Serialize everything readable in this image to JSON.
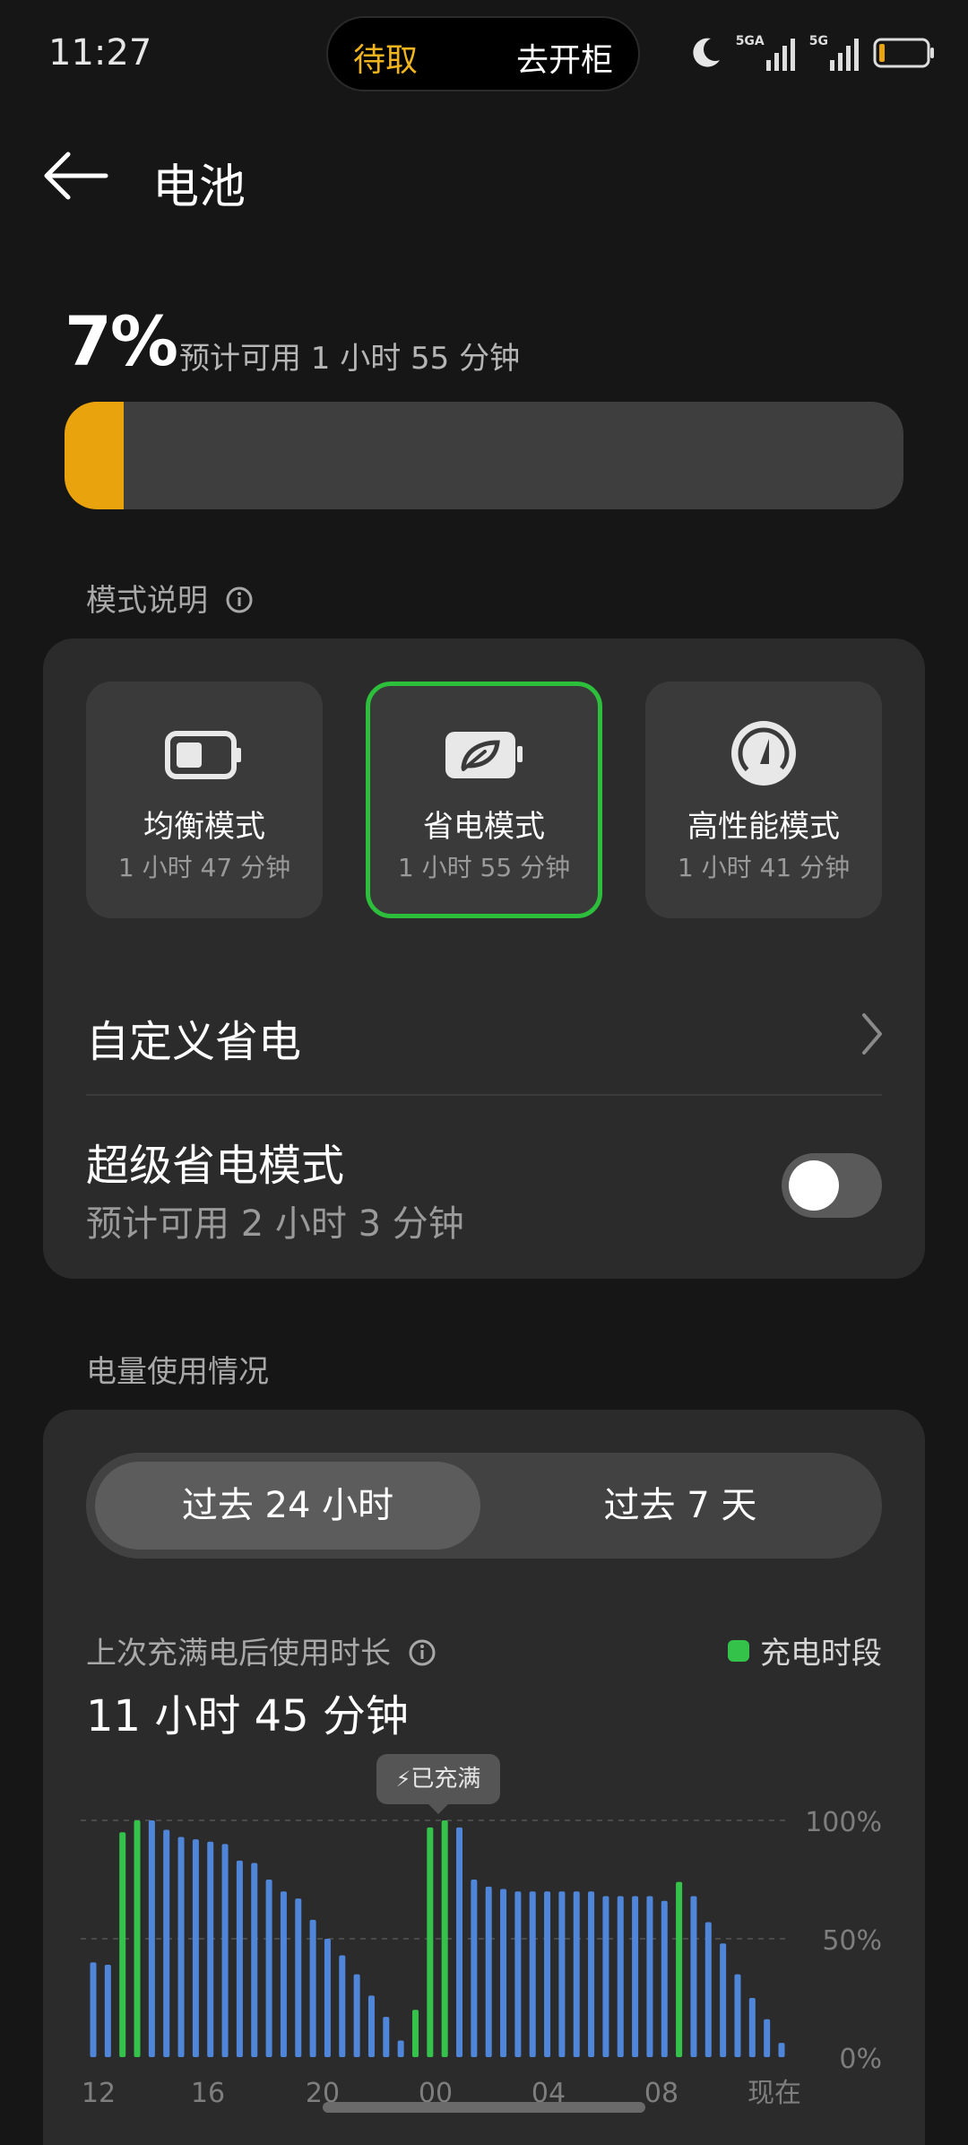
{
  "status_bar": {
    "time": "11:27",
    "island_left": "待取",
    "island_right": "去开柜",
    "signal_1_label": "5GA",
    "signal_2_label": "5G"
  },
  "header": {
    "title": "电池"
  },
  "battery": {
    "percent": "7%",
    "estimate": "预计可用 1 小时 55 分钟",
    "level": 0.07,
    "bar_color": "#e9a30d"
  },
  "modes_section": {
    "label": "模式说明",
    "modes": [
      {
        "name": "均衡模式",
        "time": "1 小时 47 分钟",
        "icon": "battery-icon",
        "selected": false
      },
      {
        "name": "省电模式",
        "time": "1 小时 55 分钟",
        "icon": "leaf-battery-icon",
        "selected": true
      },
      {
        "name": "高性能模式",
        "time": "1 小时 41 分钟",
        "icon": "speedometer-icon",
        "selected": false
      }
    ],
    "custom_label": "自定义省电",
    "super_title": "超级省电模式",
    "super_sub": "预计可用 2 小时 3 分钟",
    "super_enabled": false
  },
  "usage_section": {
    "label": "电量使用情况",
    "tabs": [
      "过去 24 小时",
      "过去 7 天"
    ],
    "active_tab": 0,
    "since_label": "上次充满电后使用时长",
    "duration": "11 小时 45 分钟",
    "legend": "充电时段",
    "full_label": "已充满"
  },
  "colors": {
    "accent_green": "#2dbe3c",
    "bar_blue": "#4f86d9",
    "charge_green": "#35c24a",
    "battery_orange": "#e9a30d"
  },
  "chart_data": {
    "type": "bar",
    "y_ticks": [
      "100%",
      "50%",
      "0%"
    ],
    "x_ticks": [
      "12",
      "16",
      "20",
      "00",
      "04",
      "08",
      "现在"
    ],
    "ylim": [
      0,
      100
    ],
    "legend": "top-right",
    "values": [
      40,
      39,
      95,
      100,
      100,
      96,
      93,
      92,
      91,
      90,
      83,
      82,
      75,
      70,
      67,
      58,
      50,
      43,
      35,
      26,
      17,
      7,
      20,
      97,
      100,
      97,
      75,
      72,
      71,
      70,
      70,
      70,
      70,
      70,
      70,
      68,
      68,
      68,
      68,
      66,
      74,
      68,
      57,
      48,
      35,
      25,
      16,
      6
    ],
    "charging": [
      false,
      false,
      true,
      true,
      false,
      false,
      false,
      false,
      false,
      false,
      false,
      false,
      false,
      false,
      false,
      false,
      false,
      false,
      false,
      false,
      false,
      false,
      true,
      true,
      true,
      false,
      false,
      false,
      false,
      false,
      false,
      false,
      false,
      false,
      false,
      false,
      false,
      false,
      false,
      false,
      true,
      false,
      false,
      false,
      false,
      false,
      false,
      false
    ]
  }
}
